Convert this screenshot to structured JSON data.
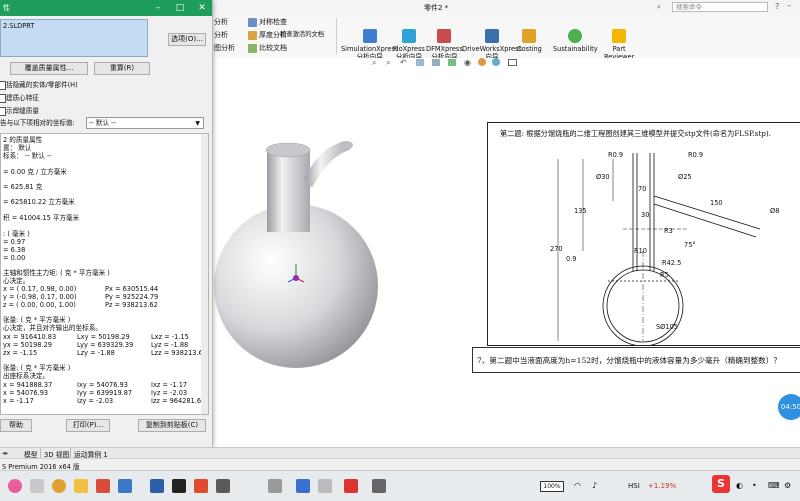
{
  "titlebar": {
    "doc_title": "零件2 *",
    "search_placeholder": "搜索命令"
  },
  "ribbon": {
    "small_items": [
      "分析",
      "对称检查",
      "检查激活的文档",
      "分析",
      "厚度分析",
      "图分析",
      "比较文档"
    ],
    "big_buttons": [
      {
        "l1": "SimulationXpress",
        "l2": "分析向导"
      },
      {
        "l1": "FloXpress",
        "l2": "分析向导"
      },
      {
        "l1": "DFMXpress",
        "l2": "分析向导"
      },
      {
        "l1": "DriveWorksXpress",
        "l2": "向导"
      },
      {
        "l1": "Costing",
        "l2": ""
      },
      {
        "l1": "Sustainability",
        "l2": ""
      },
      {
        "l1": "Part",
        "l2": "Reviewer"
      }
    ]
  },
  "dialog": {
    "title": "性",
    "file": "2.SLDPRT",
    "options_button": "选项(O)...",
    "override_button": "覆盖质量属性...",
    "recalc_button": "重算(R)",
    "checkbox_labels": [
      "括隐藏的实体/零部件(H)",
      "建质心特征",
      "示焊缝质量"
    ],
    "coord_label": "告与以下项相对的坐标值:",
    "coord_value": "-- 默认 --",
    "help_button": "帮助",
    "print_button": "打印(P)...",
    "copy_button": "复制到剪贴板(C)",
    "results": {
      "heading": "2 的质量属性",
      "config": "置： 默认",
      "coordsys": "标系： -- 默认 --",
      "density": "= 0.00 克 / 立方毫米",
      "mass": "= 625.81 克",
      "volume": "= 625810.22 立方毫米",
      "area": "积 = 41004.15  平方毫米",
      "com_head": ": ( 毫米 )",
      "com_x": "= 0.97",
      "com_y": "= 6.38",
      "com_z": "= 0.00",
      "princ_head": "主轴和惯性主力矩: ( 克 * 平方毫米 )",
      "princ_sub": "心决定。",
      "ix": "x = ( 0.17,  0.98,  0.00)",
      "iy": "y = (-0.98,  0.17,  0.00)",
      "iz": "z = ( 0.00,  0.00,  1.00)",
      "px": "Px = 630515.44",
      "py": "Py = 925224.79",
      "pz": "Pz = 938213.62",
      "inertia_head": "张量: ( 克 * 平方毫米 )",
      "inertia_sub": "心决定，并且对齐输出的坐标系。",
      "lxx": "xx = 916410.83",
      "lxy": "Lxy = 50198.29",
      "lxz": "Lxz = -1.15",
      "lyx": "yx = 50198.29",
      "lyy": "Lyy = 639329.39",
      "lyz": "Lyz = -1.88",
      "lzx": "zx = -1.15",
      "lzy": "Lzy = -1.88",
      "lzz": "Lzz = 938213.62",
      "out_head": "张量: ( 克 * 平方毫米 )",
      "out_sub": "出座标系决定。",
      "oxx": "x = 941888.37",
      "oxy": "Ixy = 54076.93",
      "oxz": "Ixz = -1.17",
      "oyx": "x = 54076.93",
      "oyy": "Iyy = 639919.87",
      "oyz": "Iyz = -2.03",
      "ozx": "x = -1.17",
      "ozy": "Izy = -2.03",
      "ozz": "Izz = 964281.63"
    }
  },
  "drawing": {
    "title": "第二题: 根据分馏烧瓶的二维工程图创建其三维模型并提交stp文件(命名为FLSP.stp).",
    "dims": [
      "R0.9",
      "R0.9",
      "Ø30",
      "Ø25",
      "70",
      "135",
      "270",
      "30",
      "150",
      "Ø8",
      "R3",
      "75°",
      "R42.5",
      "0.9",
      "R10",
      "R5",
      "SØ105"
    ]
  },
  "question7": "7、第二题中当液面高度为h=152时，分馏烧瓶中的液体容量为多少毫升（精确到整数）？",
  "timer": "04:50",
  "doc_tabs": [
    "模型",
    "3D 视图",
    "运动算例 1"
  ],
  "status": "S Premium 2016 x64 版",
  "taskbar": {
    "battery": "100%",
    "ticker": "HSI",
    "change": "+1.19%",
    "logo": "S"
  },
  "colors": {
    "dialog_title": "#1e9e5a",
    "timer": "#2f8fe0",
    "change_up": "#d62828"
  }
}
